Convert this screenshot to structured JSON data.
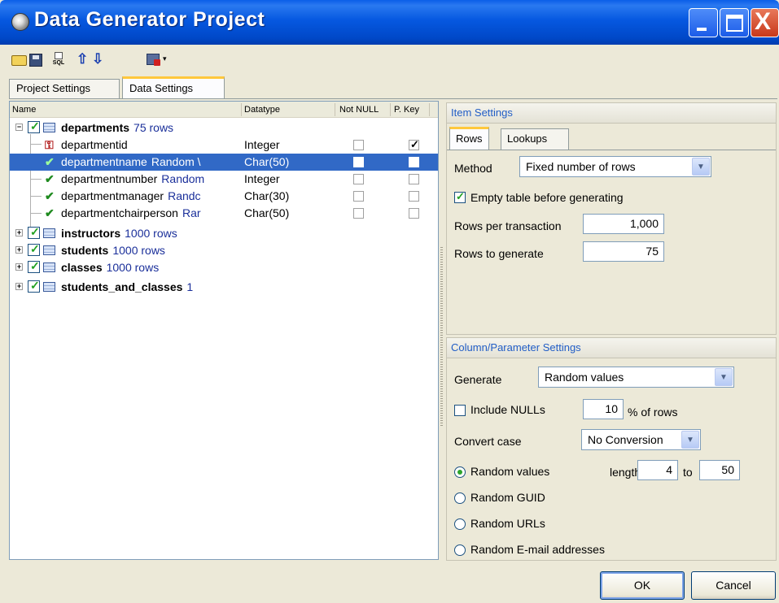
{
  "window": {
    "title": "Data Generator Project",
    "icons": {
      "app": "gear-icon",
      "minimize": "minimize-icon",
      "maximize": "maximize-icon",
      "close": "close-icon"
    },
    "close_glyph": "X"
  },
  "toolbar": {
    "sql_label": "SQL",
    "up_glyph": "⇧",
    "down_glyph": "⇩",
    "caret_glyph": "▾",
    "icons": [
      "open-folder-icon",
      "save-icon",
      "sql-icon",
      "move-up-icon",
      "move-down-icon",
      "generate-icon"
    ]
  },
  "tabs": {
    "project_settings": "Project Settings",
    "data_settings": "Data Settings"
  },
  "tree": {
    "columns": {
      "name": "Name",
      "datatype": "Datatype",
      "not_null": "Not NULL",
      "p_key": "P. Key"
    },
    "tables": [
      {
        "name": "departments",
        "rows_text": "75 rows",
        "expanded": true,
        "checked": true
      },
      {
        "name": "instructors",
        "rows_text": "1000 rows",
        "expanded": false,
        "checked": true
      },
      {
        "name": "students",
        "rows_text": "1000 rows",
        "expanded": false,
        "checked": true
      },
      {
        "name": "classes",
        "rows_text": "1000 rows",
        "expanded": false,
        "checked": true
      },
      {
        "name": "students_and_classes",
        "rows_text": "1",
        "expanded": false,
        "checked": true
      }
    ],
    "columns_of_departments": [
      {
        "name": "departmentid",
        "gen": "",
        "datatype": "Integer",
        "icon": "primary-key-icon",
        "not_null": false,
        "p_key": true
      },
      {
        "name": "departmentname",
        "gen": "Random \\",
        "datatype": "Char(50)",
        "icon": "generator-check-icon",
        "not_null": false,
        "p_key": false,
        "selected": true
      },
      {
        "name": "departmentnumber",
        "gen": "Random",
        "datatype": "Integer",
        "icon": "generator-check-icon",
        "not_null": false,
        "p_key": false
      },
      {
        "name": "departmentmanager",
        "gen": "Randc",
        "datatype": "Char(30)",
        "icon": "generator-check-icon",
        "not_null": false,
        "p_key": false
      },
      {
        "name": "departmentchairperson",
        "gen": "Rar",
        "datatype": "Char(50)",
        "icon": "generator-check-icon",
        "not_null": false,
        "p_key": false
      }
    ],
    "expander_minus": "−",
    "expander_plus": "+",
    "check_glyph": "✓",
    "pkey_check_glyph": "✓"
  },
  "item_settings": {
    "header": "Item Settings",
    "tab_rows": "Rows",
    "tab_lookups": "Lookups",
    "method_label": "Method",
    "method_value": "Fixed number of rows",
    "empty_table_label": "Empty table before generating",
    "empty_table_checked": true,
    "rows_per_transaction_label": "Rows per transaction",
    "rows_per_transaction_value": "1,000",
    "rows_to_generate_label": "Rows to generate",
    "rows_to_generate_value": "75"
  },
  "column_settings": {
    "header": "Column/Parameter Settings",
    "generate_label": "Generate",
    "generate_value": "Random values",
    "include_nulls_label": "Include NULLs",
    "include_nulls_checked": false,
    "nulls_percent": "10",
    "nulls_suffix": "% of rows",
    "convert_case_label": "Convert case",
    "convert_case_value": "No Conversion",
    "options": [
      {
        "label": "Random values",
        "selected": true
      },
      {
        "label": "Random GUID",
        "selected": false
      },
      {
        "label": "Random URLs",
        "selected": false
      },
      {
        "label": "Random E-mail addresses",
        "selected": false
      }
    ],
    "length_label": "length",
    "length_min": "4",
    "to_label": "to",
    "length_max": "50",
    "dropdown_glyph": "▼"
  },
  "buttons": {
    "ok": "OK",
    "cancel": "Cancel"
  }
}
